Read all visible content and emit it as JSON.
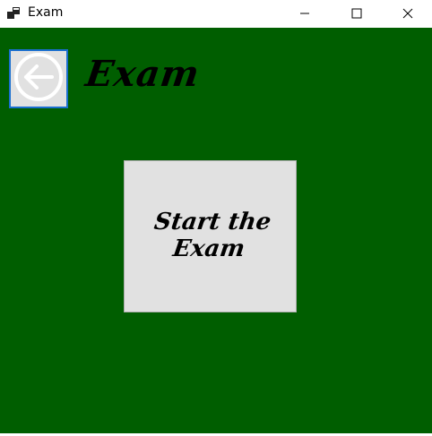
{
  "window": {
    "title": "Exam",
    "controls": {
      "minimize": "minimize-icon",
      "maximize": "maximize-icon",
      "close": "close-icon"
    }
  },
  "colors": {
    "background": "#005e00",
    "button_face": "#e1e1e1",
    "focus_border": "#1a6fcf"
  },
  "header": {
    "back_icon": "arrow-left-circle-icon",
    "title": "Exam"
  },
  "main": {
    "start_button_label": "Start the Exam"
  }
}
